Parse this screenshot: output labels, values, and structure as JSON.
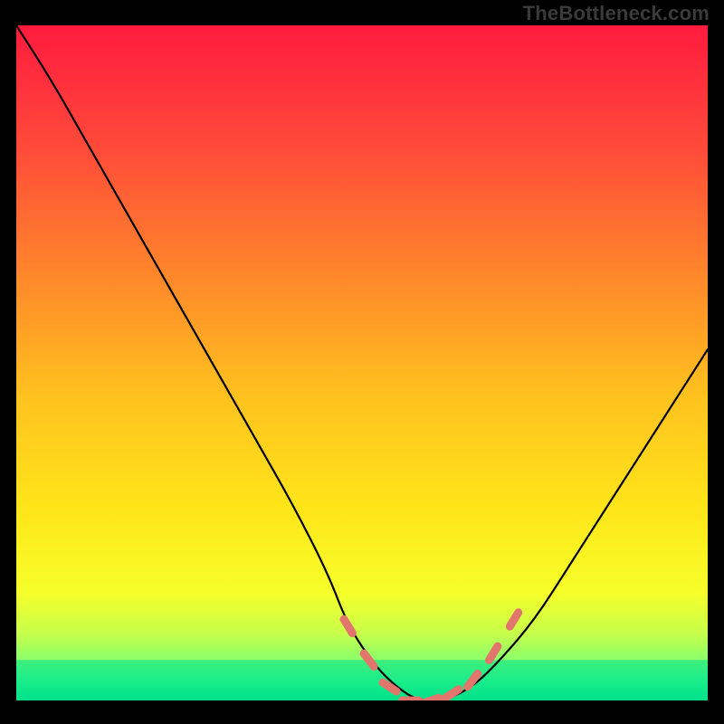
{
  "attribution": "TheBottleneck.com",
  "chart_data": {
    "type": "line",
    "title": "",
    "xlabel": "",
    "ylabel": "",
    "xlim": [
      0,
      100
    ],
    "ylim": [
      0,
      100
    ],
    "grid": false,
    "legend": false,
    "series": [
      {
        "name": "bottleneck-curve",
        "color": "#000000",
        "x": [
          0,
          5,
          10,
          15,
          20,
          25,
          30,
          35,
          40,
          45,
          48,
          52,
          55,
          58,
          62,
          66,
          70,
          75,
          80,
          85,
          90,
          95,
          100
        ],
        "y": [
          100,
          92,
          83,
          74,
          65,
          56,
          47,
          38,
          29,
          19,
          11,
          5,
          2,
          0,
          0,
          2,
          6,
          12,
          20,
          28,
          36,
          44,
          52
        ]
      }
    ],
    "annotations": [
      {
        "name": "dotted-highlight",
        "color": "#e2766d",
        "style": "dashed",
        "x": [
          48,
          51,
          54,
          57,
          60,
          63,
          66,
          69,
          72
        ],
        "y": [
          11,
          6,
          2,
          0,
          0,
          1,
          3,
          7,
          12
        ]
      }
    ],
    "background_gradient": {
      "stops": [
        {
          "offset": 0.0,
          "color": "#ff1a3e"
        },
        {
          "offset": 0.18,
          "color": "#ff4a3a"
        },
        {
          "offset": 0.38,
          "color": "#ff8a2a"
        },
        {
          "offset": 0.55,
          "color": "#ffc21e"
        },
        {
          "offset": 0.72,
          "color": "#ffe61a"
        },
        {
          "offset": 0.84,
          "color": "#f6ff2a"
        },
        {
          "offset": 0.9,
          "color": "#c8ff4a"
        },
        {
          "offset": 0.94,
          "color": "#8aff6a"
        },
        {
          "offset": 0.97,
          "color": "#3eff8a"
        },
        {
          "offset": 1.0,
          "color": "#00e08a"
        }
      ]
    },
    "green_band": {
      "y0": 0,
      "y1": 6
    }
  }
}
